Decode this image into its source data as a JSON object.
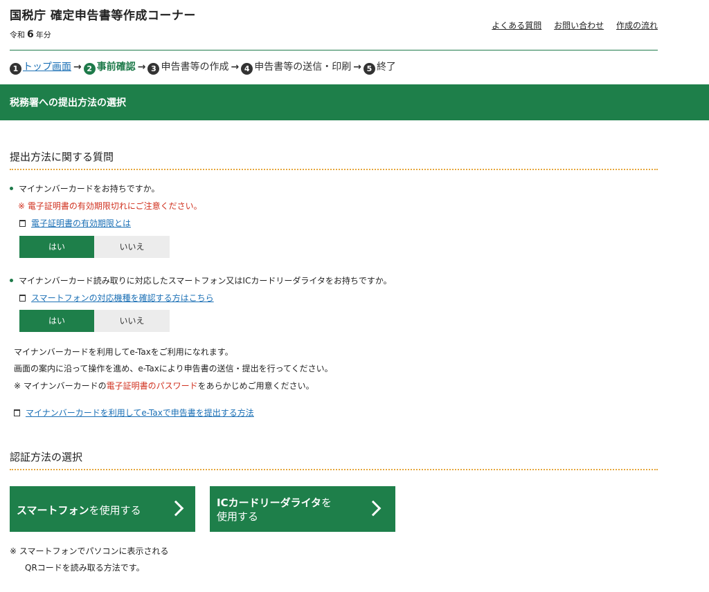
{
  "header": {
    "app_title": "国税庁 確定申告書等作成コーナー",
    "year_prefix": "令和",
    "year_num": "6",
    "year_suffix": "年分",
    "links": [
      "よくある質問",
      "お問い合わせ",
      "作成の流れ"
    ]
  },
  "steps": [
    {
      "num": "1",
      "label": "トップ画面"
    },
    {
      "num": "2",
      "label": "事前確認"
    },
    {
      "num": "3",
      "label": "申告書等の作成"
    },
    {
      "num": "4",
      "label": "申告書等の送信・印刷"
    },
    {
      "num": "5",
      "label": "終了"
    }
  ],
  "banner": {
    "title": "税務署への提出方法の選択"
  },
  "section1": {
    "title": "提出方法に関する質問",
    "q1": {
      "text": "マイナンバーカードをお持ちですか。",
      "warning": "※ 電子証明書の有効期限切れにご注意ください。",
      "link": "電子証明書の有効期限とは",
      "yes": "はい",
      "no": "いいえ"
    },
    "q2": {
      "text": "マイナンバーカード読み取りに対応したスマートフォン又はICカードリーダライタをお持ちですか。",
      "link": "スマートフォンの対応機種を確認する方はこちら",
      "yes": "はい",
      "no": "いいえ"
    },
    "info1": "マイナンバーカードを利用してe-Taxをご利用になれます。",
    "info2": "画面の案内に沿って操作を進め、e-Taxにより申告書の送信・提出を行ってください。",
    "info3_a": "※ マイナンバーカードの",
    "info3_red": "電子証明書のパスワード",
    "info3_b": "をあらかじめご用意ください。",
    "howto_link": "マイナンバーカードを利用してe-Taxで申告書を提出する方法"
  },
  "section2": {
    "title": "認証方法の選択",
    "btn_smartphone_bold": "スマートフォン",
    "btn_smartphone_rest": "を使用する",
    "btn_ic_bold": "ICカードリーダライタ",
    "btn_ic_rest1": "を",
    "btn_ic_rest2": "使用する",
    "note1": "※ スマートフォンでパソコンに表示される",
    "note2": "QRコードを読み取る方法です。"
  },
  "colors": {
    "brand_green": "#1e7f4a",
    "warning_red": "#d0301e",
    "link_blue": "#1a6fb5",
    "divider_orange": "#e6a63a"
  },
  "icons": [
    "new-window-icon",
    "chevron-right-icon"
  ]
}
